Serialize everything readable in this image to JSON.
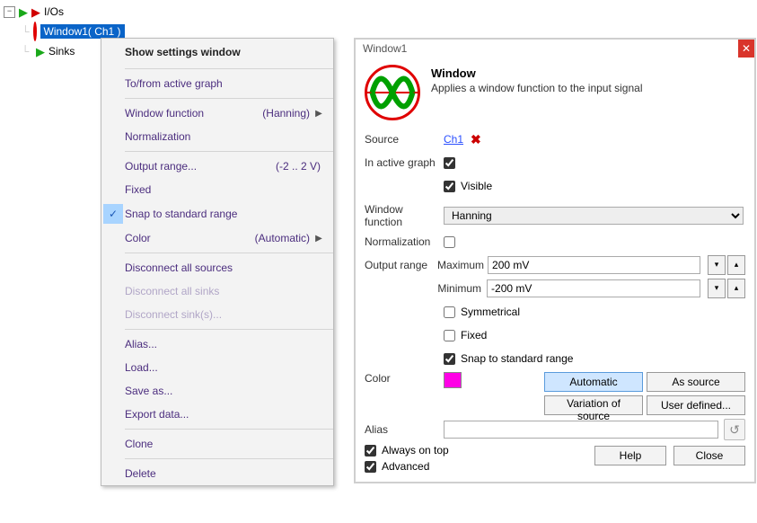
{
  "tree": {
    "ios": {
      "label": "I/Os"
    },
    "window1": {
      "label": "Window1( Ch1 )"
    },
    "sinks": {
      "label": "Sinks"
    }
  },
  "context_menu": {
    "header": "Show settings window",
    "to_from": "To/from active graph",
    "window_function": {
      "label": "Window function",
      "value": "(Hanning)"
    },
    "normalization": "Normalization",
    "output_range": {
      "label": "Output range...",
      "value": "(-2 .. 2 V)"
    },
    "fixed": "Fixed",
    "snap": "Snap to standard range",
    "color": {
      "label": "Color",
      "value": "(Automatic)"
    },
    "disconnect_sources": "Disconnect all sources",
    "disconnect_sinks": "Disconnect all sinks",
    "disconnect_sinks2": "Disconnect sink(s)...",
    "alias": "Alias...",
    "load": "Load...",
    "saveas": "Save as...",
    "export": "Export data...",
    "clone": "Clone",
    "delete": "Delete"
  },
  "panel": {
    "title": "Window1",
    "heading": "Window",
    "subtitle": "Applies a window function to the input signal",
    "labels": {
      "source": "Source",
      "in_active_graph": "In active graph",
      "visible": "Visible",
      "window_function": "Window function",
      "normalization": "Normalization",
      "output_range": "Output range",
      "maximum": "Maximum",
      "minimum": "Minimum",
      "symmetrical": "Symmetrical",
      "fixed": "Fixed",
      "snap": "Snap to standard range",
      "color": "Color",
      "automatic": "Automatic",
      "as_source": "As source",
      "variation": "Variation of source",
      "user_defined": "User defined...",
      "alias": "Alias",
      "always_on_top": "Always on top",
      "advanced": "Advanced",
      "help": "Help",
      "close": "Close"
    },
    "values": {
      "source_link": "Ch1",
      "window_function": "Hanning",
      "maximum": "200 mV",
      "minimum": "-200 mV",
      "alias": "",
      "color_swatch": "#ff00e6"
    },
    "checks": {
      "in_active_graph": true,
      "visible": true,
      "normalization": false,
      "symmetrical": false,
      "fixed": false,
      "snap": true,
      "always_on_top": true,
      "advanced": true
    }
  }
}
